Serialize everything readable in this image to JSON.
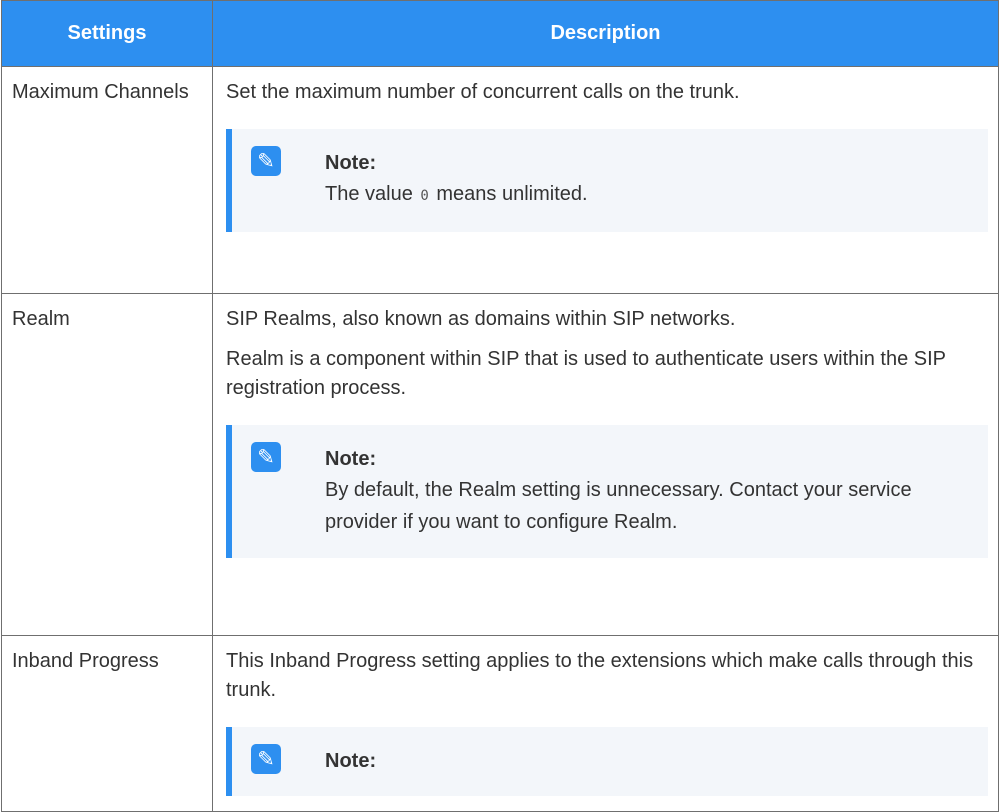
{
  "table": {
    "headers": {
      "settings": "Settings",
      "description": "Description"
    },
    "rows": [
      {
        "name": "Maximum Channels",
        "paragraphs": [
          "Set the maximum number of concurrent calls on the trunk."
        ],
        "note": {
          "title": "Note:",
          "before": "The value ",
          "code": "0",
          "after": " means unlimited."
        }
      },
      {
        "name": "Realm",
        "paragraphs": [
          "SIP Realms, also known as domains within SIP networks.",
          "Realm is a component within SIP that is used to authenticate users within the SIP registration process."
        ],
        "note": {
          "title": "Note:",
          "body": "By default, the Realm setting is unnecessary. Contact your service provider if you want to configure Realm."
        }
      },
      {
        "name": "Inband Progress",
        "paragraphs": [
          "This Inband Progress setting applies to the extensions which make calls through this trunk."
        ],
        "note": {
          "title": "Note:"
        }
      }
    ]
  },
  "icons": {
    "note": "pencil-note-icon"
  },
  "colors": {
    "header_bg": "#2d8ff0",
    "accent": "#2d8ff0",
    "note_bg": "#f3f6fa"
  }
}
